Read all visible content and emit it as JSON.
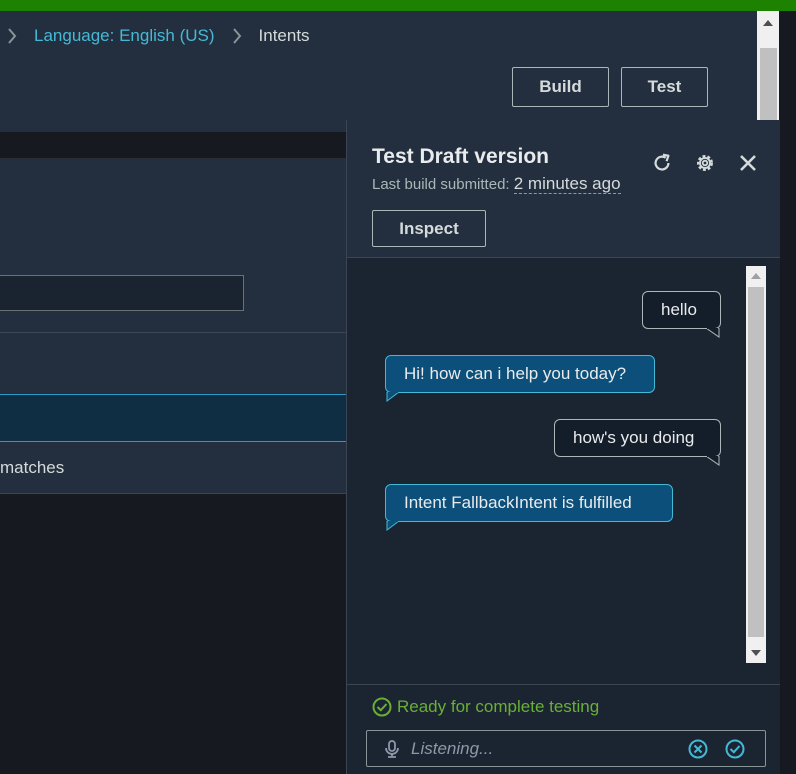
{
  "breadcrumb": {
    "items": [
      "Language: English (US)",
      "Intents"
    ]
  },
  "header": {
    "build_label": "Build",
    "test_label": "Test"
  },
  "content": {
    "row_text": "matches"
  },
  "test_panel": {
    "title": "Test Draft version",
    "last_build_label": "Last build submitted:",
    "last_build_time": "2 minutes ago",
    "inspect_label": "Inspect",
    "icons": [
      "refresh-icon",
      "gear-icon",
      "close-icon"
    ],
    "messages": [
      {
        "from": "user",
        "text": "hello"
      },
      {
        "from": "bot",
        "text": "Hi! how can i help you today?"
      },
      {
        "from": "user",
        "text": "how's you doing"
      },
      {
        "from": "bot",
        "text": "Intent FallbackIntent is fulfilled"
      }
    ],
    "status_text": "Ready for complete testing",
    "input_placeholder": "Listening..."
  },
  "colors": {
    "top_bar": "#1d8102",
    "link": "#44b9d6",
    "bot_bubble": "#0b4f7a",
    "status_ok": "#6aaf35"
  }
}
